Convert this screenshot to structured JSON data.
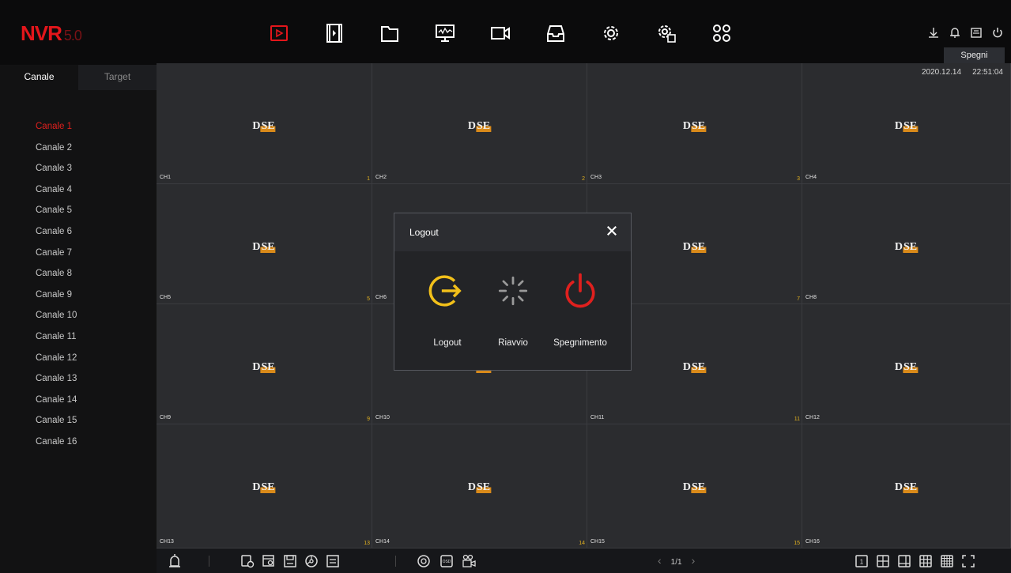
{
  "app": {
    "logo_main": "NVR",
    "logo_version": "5.0"
  },
  "topnav": {
    "icons": [
      "playback-icon",
      "video-file-icon",
      "folder-icon",
      "monitor-icon",
      "camera-icon",
      "storage-icon",
      "settings-gear-icon",
      "advanced-settings-icon",
      "apps-grid-icon"
    ]
  },
  "top_right": {
    "icons": [
      "download-icon",
      "bell-icon",
      "save-icon",
      "power-icon"
    ],
    "tooltip": "Spegni"
  },
  "sidebar": {
    "tabs": [
      "Canale",
      "Target"
    ],
    "channels": [
      "Canale 1",
      "Canale 2",
      "Canale 3",
      "Canale 4",
      "Canale 5",
      "Canale 6",
      "Canale 7",
      "Canale 8",
      "Canale 9",
      "Canale 10",
      "Canale 11",
      "Canale 12",
      "Canale 13",
      "Canale 14",
      "Canale 15",
      "Canale 16"
    ],
    "selected_channel": "Canale 1"
  },
  "datetime": {
    "date": "2020.12.14",
    "time": "22:51:04"
  },
  "grid": {
    "watermark_d": "D",
    "watermark_se": "SE",
    "cells": [
      {
        "name": "CH1",
        "num": "1"
      },
      {
        "name": "CH2",
        "num": "2"
      },
      {
        "name": "CH3",
        "num": "3"
      },
      {
        "name": "CH4",
        "num": ""
      },
      {
        "name": "CH5",
        "num": "5"
      },
      {
        "name": "CH6",
        "num": ""
      },
      {
        "name": "",
        "num": "7"
      },
      {
        "name": "CH8",
        "num": ""
      },
      {
        "name": "CH9",
        "num": "9"
      },
      {
        "name": "CH10",
        "num": ""
      },
      {
        "name": "CH11",
        "num": "11"
      },
      {
        "name": "CH12",
        "num": ""
      },
      {
        "name": "CH13",
        "num": "13"
      },
      {
        "name": "CH14",
        "num": "14"
      },
      {
        "name": "CH15",
        "num": "15"
      },
      {
        "name": "CH16",
        "num": ""
      }
    ]
  },
  "bottombar": {
    "pager": "1/1",
    "left_icons": [
      "alarm-icon",
      "record-icon",
      "search-record-icon",
      "save-record-icon",
      "ptz-icon",
      "playlist-icon",
      "color-icon",
      "osd-icon",
      "camera-settings-icon"
    ],
    "layout_icons": [
      "layout-1-icon",
      "layout-4-icon",
      "layout-6-icon",
      "layout-9-icon",
      "layout-16-icon",
      "fullscreen-icon"
    ]
  },
  "modal": {
    "title": "Logout",
    "options": [
      {
        "label": "Logout",
        "icon": "logout-icon",
        "color": "#f2c01a"
      },
      {
        "label": "Riavvio",
        "icon": "restart-icon",
        "color": "#9a9a9a"
      },
      {
        "label": "Spegnimento",
        "icon": "shutdown-icon",
        "color": "#e0201e"
      }
    ]
  },
  "colors": {
    "accent_red": "#e3161b",
    "background": "#1f2023",
    "cell": "#2b2c2f"
  }
}
